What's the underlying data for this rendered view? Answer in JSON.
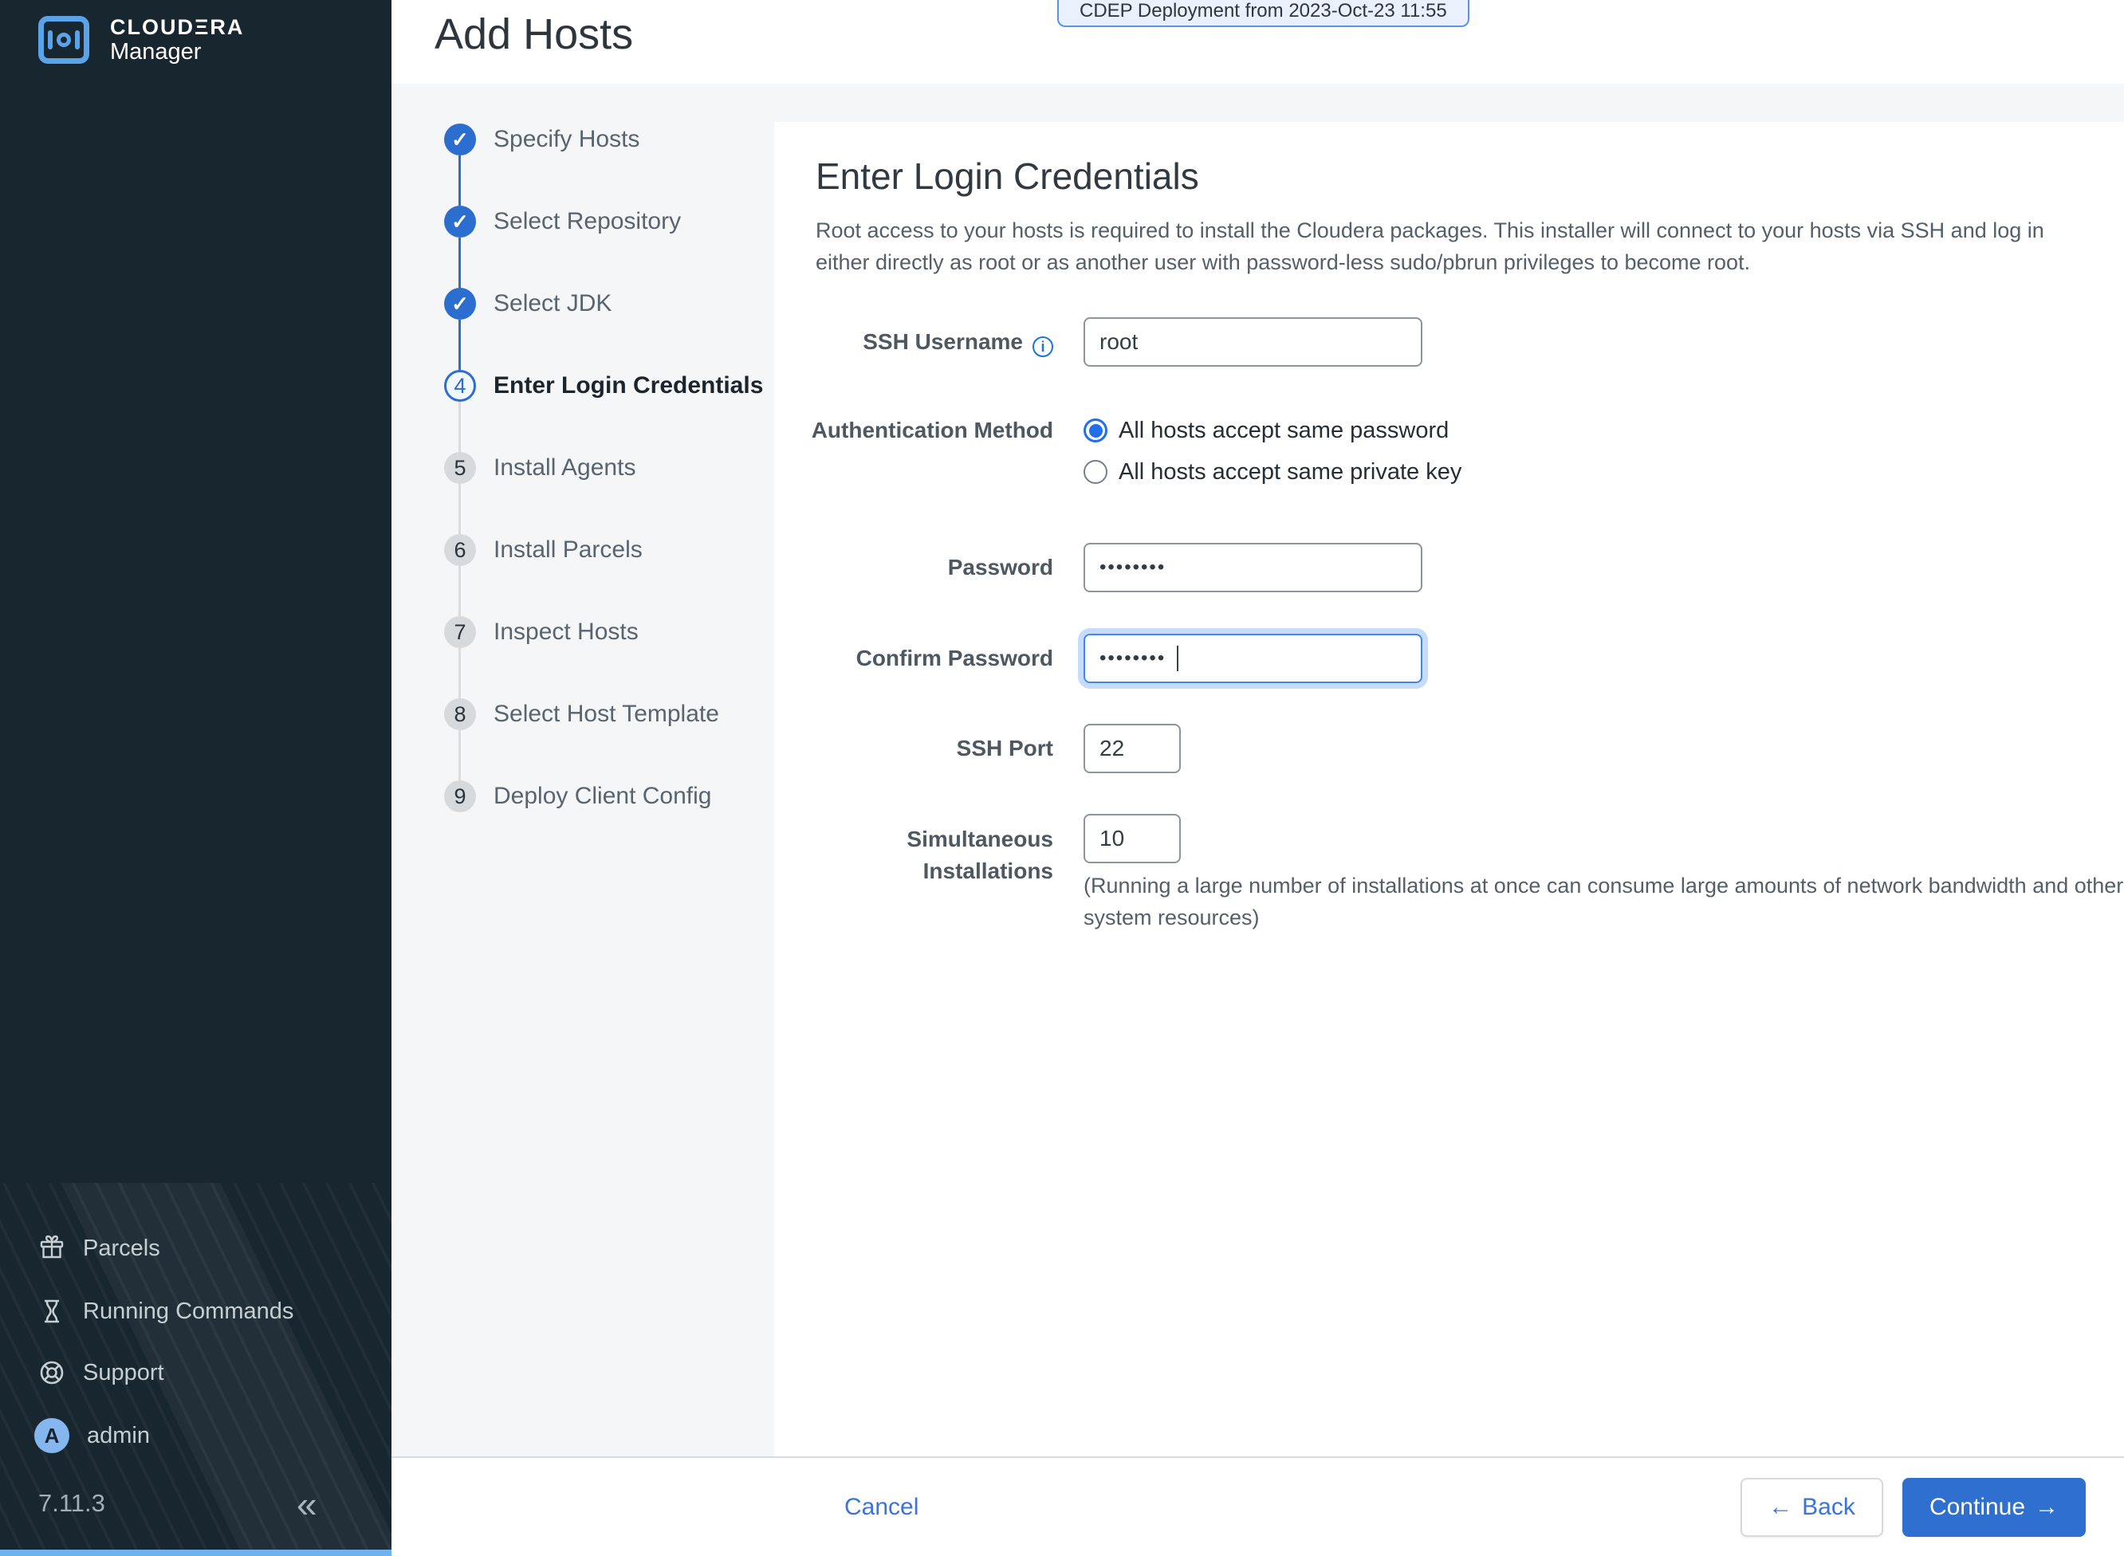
{
  "palette": {
    "sidebar_bg": "#18262f",
    "primary_blue": "#2c6dd0",
    "radio_focus_blue": "#2270e8",
    "link_blue": "#3b73d9",
    "panel_gray": "#f5f6f7",
    "logo_blue": "#5ba3e9",
    "sidebar_bottom_strip": "#70b1ef"
  },
  "icons": {
    "check": "✓",
    "info": "i",
    "collapse": "«",
    "back_arrow": "←",
    "continue_arrow": "→"
  },
  "brand": {
    "line1": "CLOUDΞRA",
    "line2": "Manager",
    "version": "7.11.3",
    "avatar_letter": "A"
  },
  "header": {
    "title": "Add Hosts",
    "deployment_badge": "CDEP Deployment from 2023-Oct-23 11:55"
  },
  "sidebar_nav": {
    "parcels": "Parcels",
    "running_commands": "Running Commands",
    "support": "Support",
    "admin": "admin"
  },
  "wizard": {
    "steps": [
      {
        "num": "1",
        "label": "Specify Hosts",
        "state": "done"
      },
      {
        "num": "2",
        "label": "Select Repository",
        "state": "done"
      },
      {
        "num": "3",
        "label": "Select JDK",
        "state": "done"
      },
      {
        "num": "4",
        "label": "Enter Login Credentials",
        "state": "current"
      },
      {
        "num": "5",
        "label": "Install Agents",
        "state": "pending"
      },
      {
        "num": "6",
        "label": "Install Parcels",
        "state": "pending"
      },
      {
        "num": "7",
        "label": "Inspect Hosts",
        "state": "pending"
      },
      {
        "num": "8",
        "label": "Select Host Template",
        "state": "pending"
      },
      {
        "num": "9",
        "label": "Deploy Client Config",
        "state": "pending"
      }
    ]
  },
  "content": {
    "heading": "Enter Login Credentials",
    "description": "Root access to your hosts is required to install the Cloudera packages. This installer will connect to your hosts via SSH and log in either directly as root or as another user with password-less sudo/pbrun privileges to become root.",
    "form": {
      "ssh_username": {
        "label": "SSH Username",
        "value": "root"
      },
      "auth_method": {
        "label": "Authentication Method",
        "options": [
          {
            "label": "All hosts accept same password",
            "selected": true
          },
          {
            "label": "All hosts accept same private key",
            "selected": false
          }
        ]
      },
      "password": {
        "label": "Password",
        "value": "••••••••"
      },
      "confirm_password": {
        "label": "Confirm Password",
        "value": "••••••••"
      },
      "ssh_port": {
        "label": "SSH Port",
        "value": "22"
      },
      "simultaneous_installations": {
        "label_line1": "Simultaneous",
        "label_line2": "Installations",
        "value": "10",
        "help": "(Running a large number of installations at once can consume large amounts of network bandwidth and other system resources)"
      }
    }
  },
  "footer": {
    "cancel": "Cancel",
    "back": "Back",
    "continue": "Continue"
  }
}
